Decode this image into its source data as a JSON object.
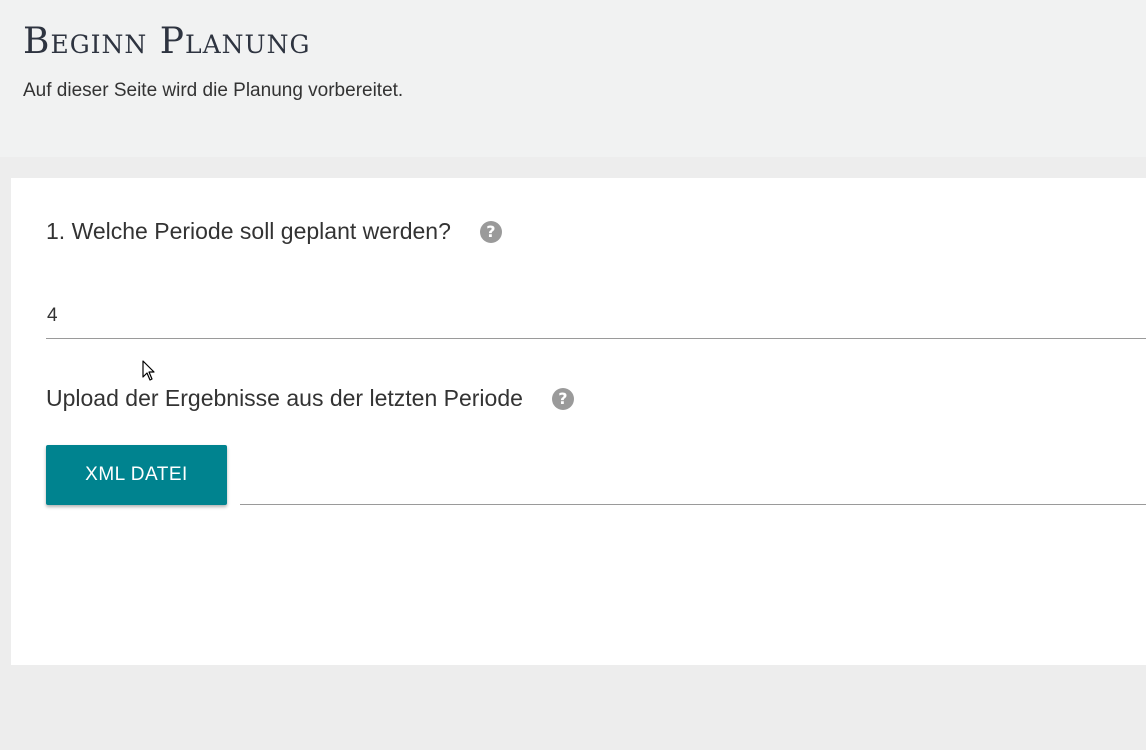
{
  "header": {
    "title": "Beginn Planung",
    "subtitle": "Auf dieser Seite wird die Planung vorbereitet."
  },
  "form": {
    "period_question": "1. Welche Periode soll geplant werden?",
    "period_value": "4",
    "upload_label": "Upload der Ergebnisse aus der letzten Periode",
    "upload_button_label": "XML DATEI",
    "help_glyph": "?",
    "file_path_value": ""
  },
  "colors": {
    "accent": "#00838f",
    "header_bg": "#f1f2f2",
    "page_bg": "#ededed",
    "help_icon": "#9a9a9a"
  },
  "icons": {
    "help": "help-circle-icon",
    "cursor": "mouse-pointer-icon"
  }
}
